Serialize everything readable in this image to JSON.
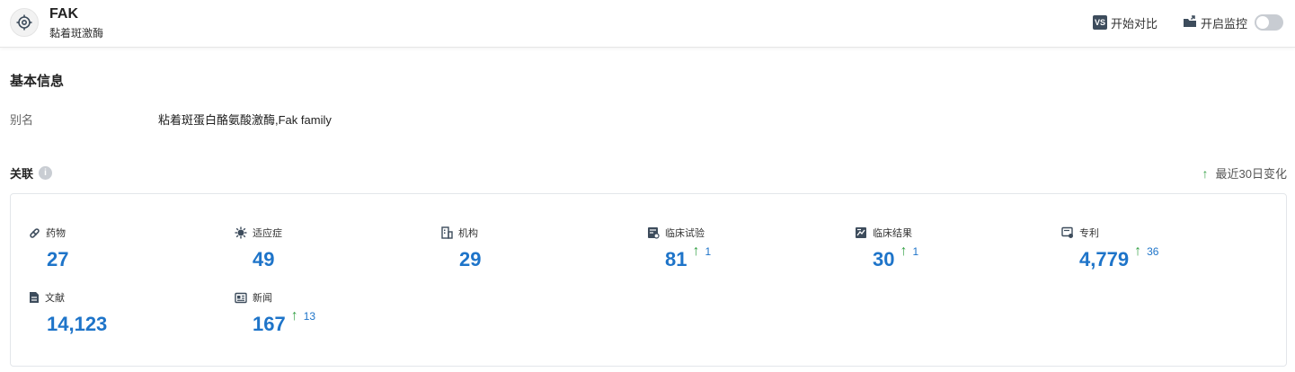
{
  "header": {
    "title": "FAK",
    "subtitle": "黏着斑激酶",
    "compare_badge": "VS",
    "compare_label": "开始对比",
    "monitor_label": "开启监控"
  },
  "basic": {
    "section_title": "基本信息",
    "alias_label": "别名",
    "alias_value": "粘着斑蛋白酪氨酸激酶,Fak family"
  },
  "relations": {
    "title": "关联",
    "info_glyph": "i",
    "recent_arrow": "↑",
    "recent_label": "最近30日变化",
    "stats": [
      {
        "label": "药物",
        "value": "27",
        "delta": ""
      },
      {
        "label": "适应症",
        "value": "49",
        "delta": ""
      },
      {
        "label": "机构",
        "value": "29",
        "delta": ""
      },
      {
        "label": "临床试验",
        "value": "81",
        "delta": "1"
      },
      {
        "label": "临床结果",
        "value": "30",
        "delta": "1"
      },
      {
        "label": "专利",
        "value": "4,779",
        "delta": "36"
      },
      {
        "label": "文献",
        "value": "14,123",
        "delta": ""
      },
      {
        "label": "新闻",
        "value": "167",
        "delta": "13"
      }
    ],
    "delta_arrow": "↑"
  },
  "colors": {
    "value_blue": "#1e74c9",
    "increase_green": "#3aa34a"
  },
  "icons": [
    "target-icon",
    "vs-icon",
    "monitor-icon",
    "info-icon",
    "pill-icon",
    "virus-icon",
    "building-icon",
    "clinical-trial-icon",
    "clinical-result-icon",
    "patent-icon",
    "document-icon",
    "news-icon",
    "up-arrow-icon"
  ]
}
